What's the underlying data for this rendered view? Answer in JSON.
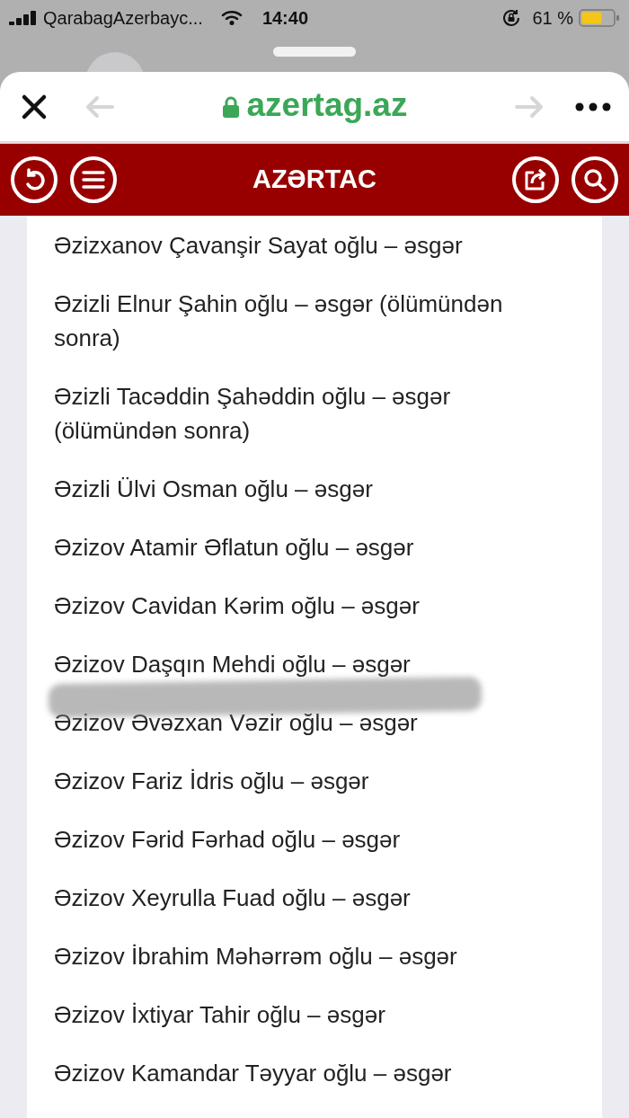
{
  "status_bar": {
    "carrier": "QarabagAzerbayc...",
    "time": "14:40",
    "battery": "61 %"
  },
  "browser": {
    "url": "azertag.az",
    "back": {
      "disabled": true
    },
    "forward": {
      "disabled": true
    }
  },
  "site_header": {
    "title": "AZƏRTAC"
  },
  "items": [
    {
      "text": "Əzizxanov Çavanşir Sayat oğlu – əsgər",
      "scribbled": false
    },
    {
      "text": "Əzizli Elnur Şahin oğlu – əsgər (ölümündən sonra)",
      "scribbled": false
    },
    {
      "text": "Əzizli Tacəddin Şahəddin oğlu – əsgər (ölümündən sonra)",
      "scribbled": false
    },
    {
      "text": "Əzizli Ülvi Osman oğlu – əsgər",
      "scribbled": false
    },
    {
      "text": "Əzizov Atamir Əflatun oğlu – əsgər",
      "scribbled": false
    },
    {
      "text": "Əzizov Cavidan Kərim oğlu – əsgər",
      "scribbled": false
    },
    {
      "text": "Əzizov Daşqın Mehdi oğlu – əsgər",
      "scribbled": false
    },
    {
      "text": "Əzizov Əvəzxan Vəzir oğlu – əsgər",
      "scribbled": true
    },
    {
      "text": "Əzizov Fariz İdris oğlu – əsgər",
      "scribbled": false
    },
    {
      "text": "Əzizov Fərid Fərhad oğlu – əsgər",
      "scribbled": false
    },
    {
      "text": "Əzizov Xeyrulla Fuad oğlu – əsgər",
      "scribbled": false
    },
    {
      "text": "Əzizov İbrahim Məhərrəm oğlu – əsgər",
      "scribbled": false
    },
    {
      "text": "Əzizov İxtiyar Tahir oğlu – əsgər",
      "scribbled": false
    },
    {
      "text": "Əzizov Kamandar Təyyar oğlu – əsgər",
      "scribbled": false
    }
  ]
}
